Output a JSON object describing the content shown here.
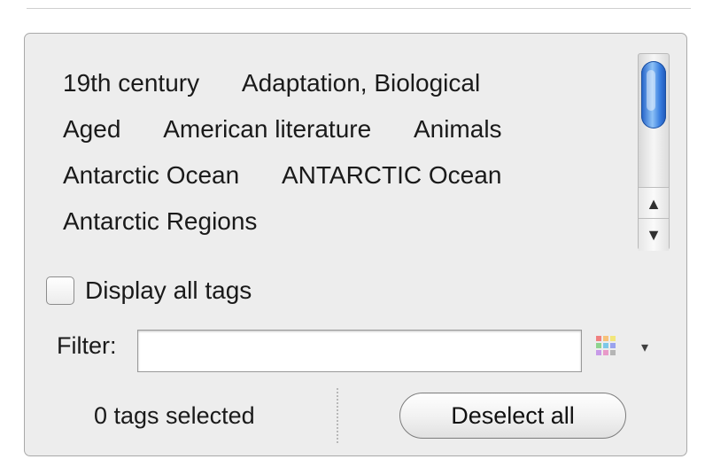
{
  "tags": {
    "rows": [
      [
        "19th century",
        "Adaptation, Biological"
      ],
      [
        "Aged",
        "American literature",
        "Animals"
      ],
      [
        "Antarctic Ocean",
        "ANTARCTIC Ocean"
      ],
      [
        "Antarctic Regions"
      ]
    ]
  },
  "scrollbar": {
    "up_arrow": "▲",
    "down_arrow": "▼",
    "icons": [
      "scroll-up-icon",
      "scroll-down-icon"
    ]
  },
  "display_all": {
    "label": "Display all tags",
    "checked": false
  },
  "filter": {
    "label": "Filter:",
    "value": "",
    "placeholder": "",
    "menu_arrow": "▾",
    "color_grid_colors": [
      "#f08080",
      "#f7c27a",
      "#f2e67a",
      "#8fd48f",
      "#7ec8e8",
      "#9aa3ee",
      "#c79ae8",
      "#e89ac9",
      "#b5b5b5"
    ]
  },
  "footer": {
    "selected_count_text": "0 tags selected",
    "deselect_label": "Deselect all"
  }
}
